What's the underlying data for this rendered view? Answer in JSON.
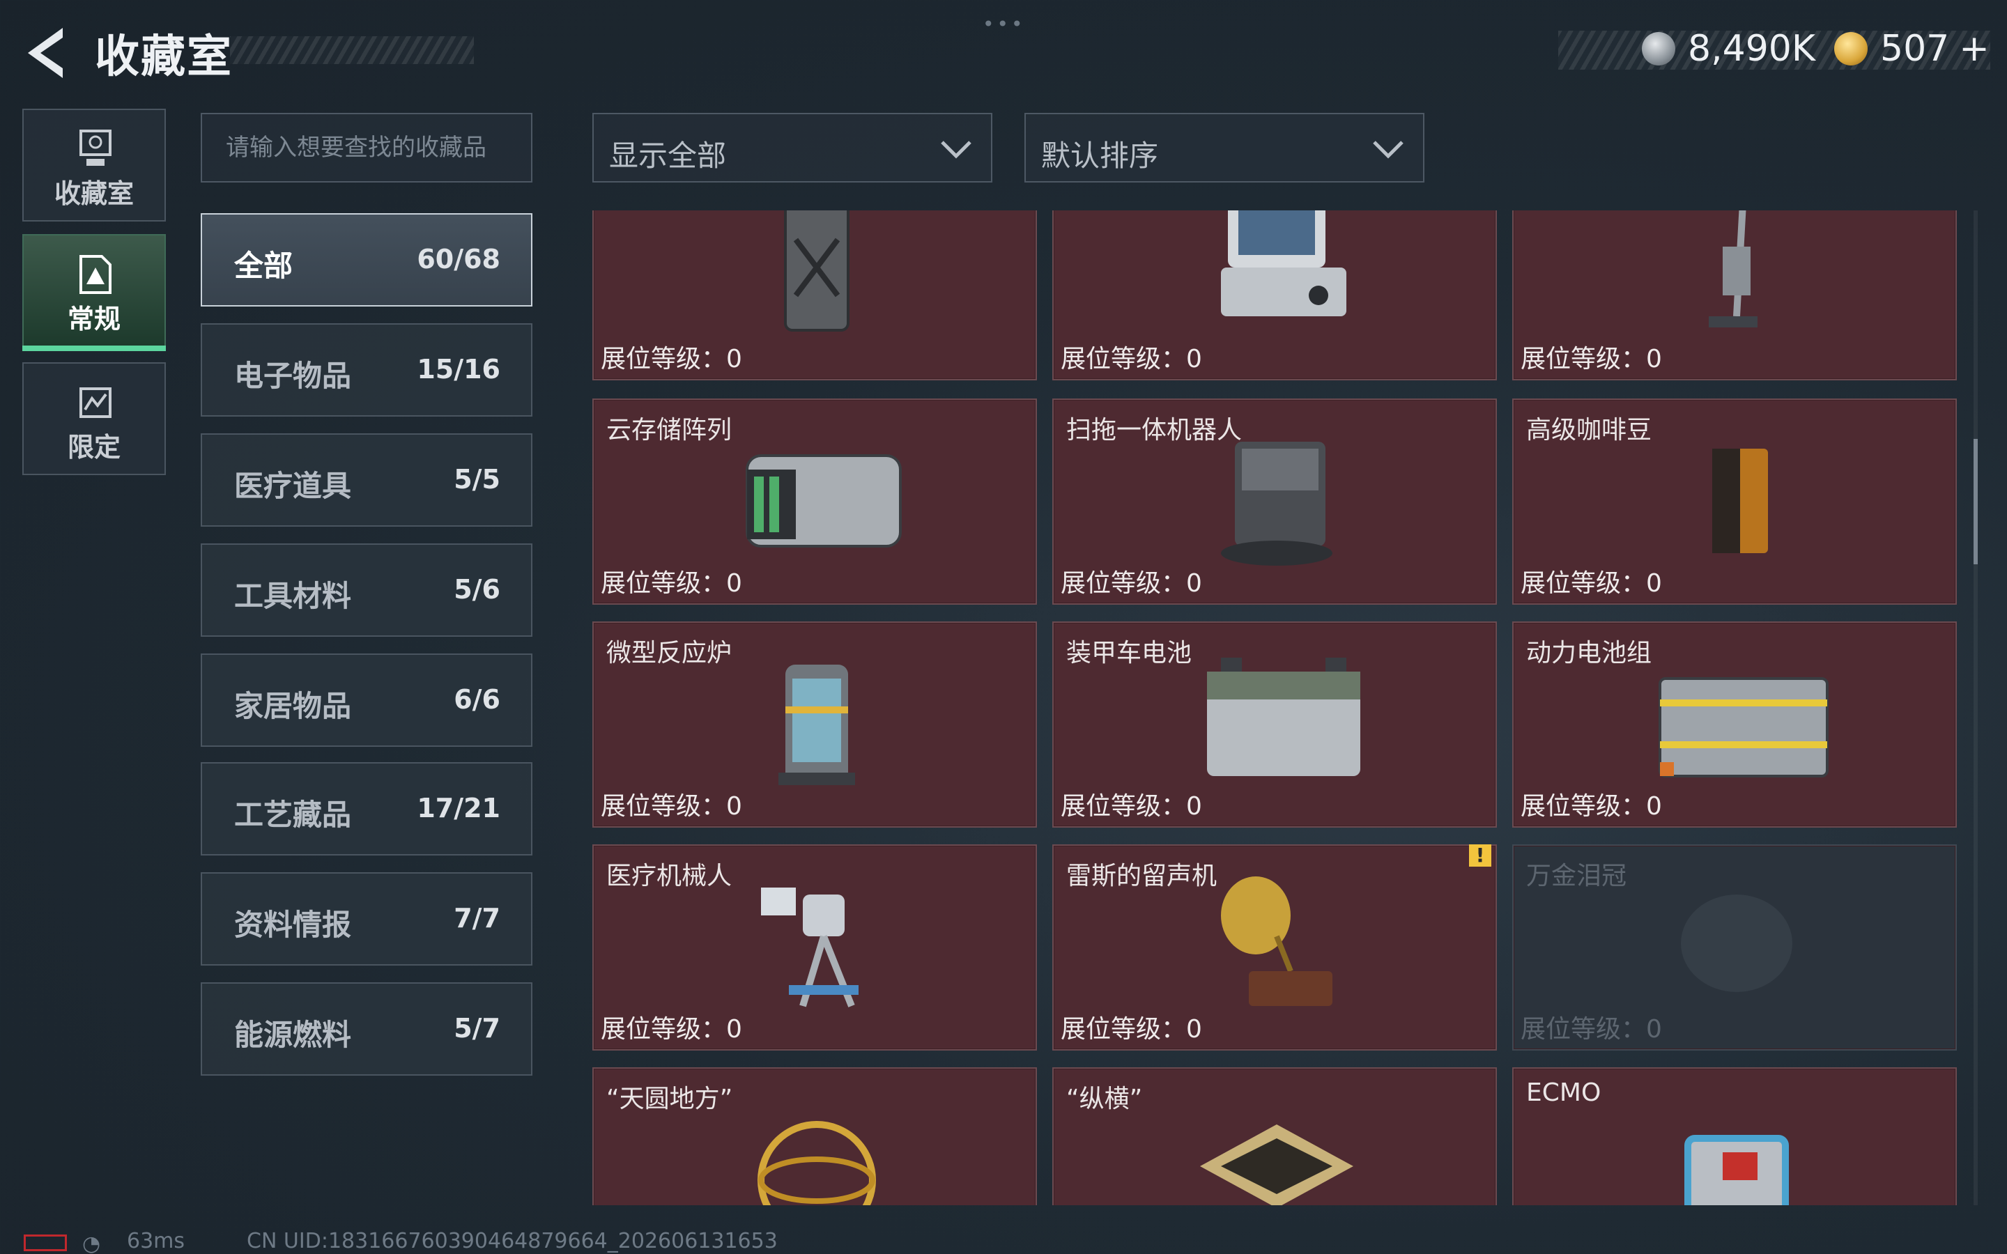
{
  "header": {
    "title": "收藏室",
    "currency_silver": "8,490K",
    "currency_gold": "507",
    "currency_gold_add": "+",
    "more": "•••"
  },
  "nav": [
    {
      "label": "收藏室",
      "icon": "trophy-icon",
      "active": false
    },
    {
      "label": "常规",
      "icon": "document-icon",
      "active": true
    },
    {
      "label": "限定",
      "icon": "map-icon",
      "active": false
    }
  ],
  "search": {
    "placeholder": "请输入想要查找的收藏品"
  },
  "categories": [
    {
      "label": "全部",
      "count": "60/68",
      "active": true
    },
    {
      "label": "电子物品",
      "count": "15/16"
    },
    {
      "label": "医疗道具",
      "count": "5/5"
    },
    {
      "label": "工具材料",
      "count": "5/6"
    },
    {
      "label": "家居物品",
      "count": "6/6"
    },
    {
      "label": "工艺藏品",
      "count": "17/21"
    },
    {
      "label": "资料情报",
      "count": "7/7"
    },
    {
      "label": "能源燃料",
      "count": "5/7"
    }
  ],
  "filters": {
    "show": "显示全部",
    "sort": "默认排序"
  },
  "items": [
    {
      "name": "",
      "level": "展位等级：0",
      "icon": "fuel-can-icon"
    },
    {
      "name": "",
      "level": "展位等级：0",
      "icon": "monitor-device-icon"
    },
    {
      "name": "",
      "level": "展位等级：0",
      "icon": "vacuum-cleaner-icon"
    },
    {
      "name": "云存储阵列",
      "level": "展位等级：0",
      "icon": "storage-array-icon"
    },
    {
      "name": "扫拖一体机器人",
      "level": "展位等级：0",
      "icon": "robot-vacuum-icon"
    },
    {
      "name": "高级咖啡豆",
      "level": "展位等级：0",
      "icon": "coffee-bag-icon"
    },
    {
      "name": "微型反应炉",
      "level": "展位等级：0",
      "icon": "reactor-icon"
    },
    {
      "name": "装甲车电池",
      "level": "展位等级：0",
      "icon": "battery-icon"
    },
    {
      "name": "动力电池组",
      "level": "展位等级：0",
      "icon": "battery-pack-icon"
    },
    {
      "name": "医疗机械人",
      "level": "展位等级：0",
      "icon": "medical-robot-icon"
    },
    {
      "name": "雷斯的留声机",
      "level": "展位等级：0",
      "icon": "gramophone-icon",
      "warning": true
    },
    {
      "name": "万金泪冠",
      "level": "展位等级：0",
      "icon": "crown-icon",
      "locked": true
    },
    {
      "name": "“天圆地方”",
      "level": "",
      "icon": "armillary-sphere-icon"
    },
    {
      "name": "“纵横”",
      "level": "",
      "icon": "chessboard-icon"
    },
    {
      "name": "ECMO",
      "level": "",
      "icon": "ecmo-machine-icon"
    }
  ],
  "status": {
    "ping": "63ms",
    "uid": "CN UID:18316676039046487966​4_202606131653"
  },
  "colors": {
    "card": "#4e2a31",
    "accent_green": "#5cd59e",
    "warning": "#f2c43d"
  }
}
